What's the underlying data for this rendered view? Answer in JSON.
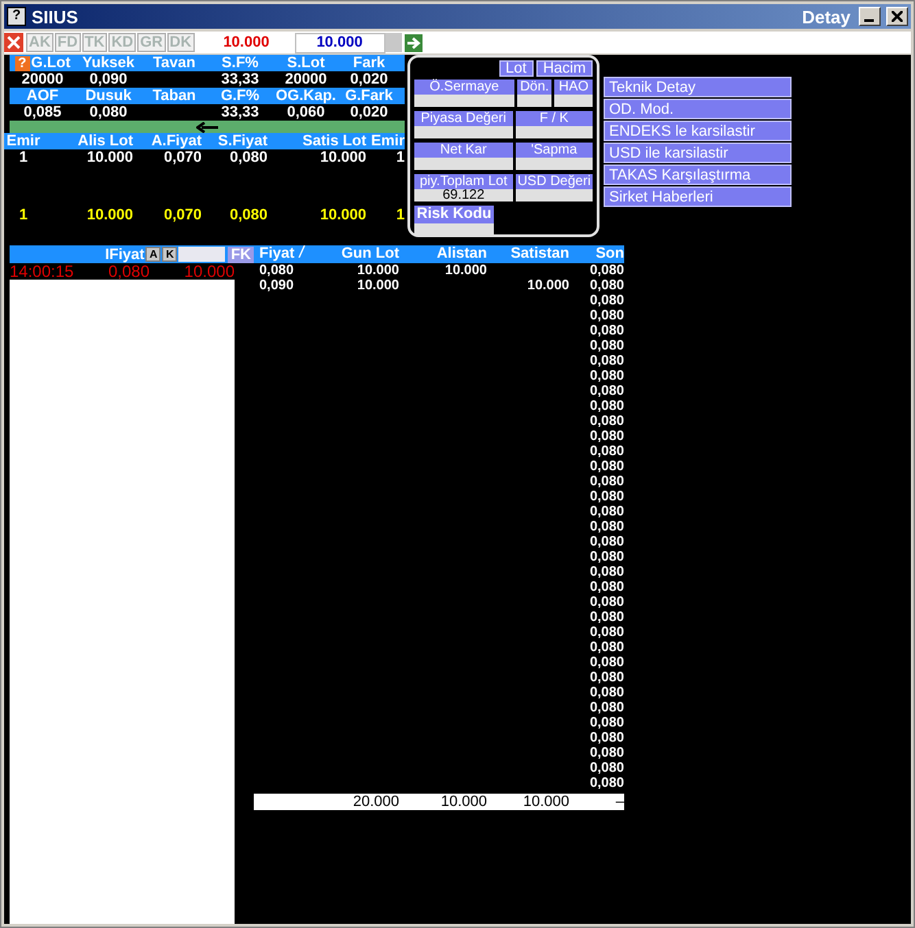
{
  "window": {
    "icon": "?",
    "title": "SIIUS",
    "subtitle": "Detay"
  },
  "toolbar": {
    "buttons": [
      {
        "label": "AK",
        "disabled": true
      },
      {
        "label": "FD",
        "disabled": true
      },
      {
        "label": "TK",
        "disabled": true
      },
      {
        "label": "KD",
        "disabled": true
      },
      {
        "label": "GR",
        "disabled": true
      },
      {
        "label": "DK",
        "disabled": true
      }
    ],
    "field_1": "10.000",
    "field_2": "10.000"
  },
  "summary": {
    "help": "?",
    "rows": [
      [
        {
          "header": "G.Lot",
          "value": "20000"
        },
        {
          "header": "Yuksek",
          "value": "0,090"
        },
        {
          "header": "Tavan"
        },
        {
          "header": "S.F%",
          "value": "33,33"
        },
        {
          "header": "S.Lot",
          "value": "20000"
        },
        {
          "header": "Fark",
          "value": "0,020"
        }
      ],
      [
        {
          "header": "AOF",
          "value": "0,085"
        },
        {
          "header": "Dusuk",
          "value": "0,080"
        },
        {
          "header": "Taban"
        },
        {
          "header": "G.F%",
          "value": "33,33"
        },
        {
          "header": "OG.Kap.",
          "value": "0,060"
        },
        {
          "header": "G.Fark",
          "value": "0,020"
        }
      ]
    ]
  },
  "order_book": {
    "columns": [
      "Emir",
      "Alis Lot",
      "A.Fiyat",
      "S.Fiyat",
      "Satis Lot",
      "Emir"
    ],
    "rows": [
      [
        "1",
        "10.000",
        "0,070",
        "0,080",
        "10.000",
        "1"
      ]
    ],
    "total": [
      "1",
      "10.000",
      "0,070",
      "0,080",
      "10.000",
      "1"
    ]
  },
  "popup": {
    "buttons": [
      "Lot",
      "Hacim"
    ],
    "rows": [
      [
        {
          "label": "Ö.Sermaye",
          "kind": "normal"
        },
        {
          "label": "Dön.",
          "kind": "normal"
        },
        {
          "label": "HAO",
          "kind": "normal"
        }
      ],
      [
        {
          "label": "Piyasa Değeri",
          "kind": "normal"
        },
        {
          "label": "F / K",
          "kind": "normal"
        }
      ],
      [
        {
          "label": "Net Kar",
          "kind": "normal"
        },
        {
          "label": "'Sapma",
          "kind": "normal"
        }
      ],
      [
        {
          "label": "piy.Toplam Lot",
          "value": "69.122",
          "kind": "normal"
        },
        {
          "label": "USD Değeri",
          "kind": "normal"
        }
      ],
      [
        {
          "label": "Risk Kodu",
          "kind": "large"
        }
      ]
    ]
  },
  "menu": [
    "Teknik Detay",
    "OD. Mod.",
    "ENDEKS le karsilastir",
    "USD ile karsilastir",
    "TAKAS Karşılaştırma",
    "Sirket Haberleri"
  ],
  "time_sales": {
    "filter_label": "IFiyat",
    "buttons": [
      "A",
      "K"
    ],
    "fk_button": "FK",
    "rows": [
      {
        "time": "14:00:15",
        "price": "0,080",
        "lot": "10.000"
      }
    ]
  },
  "trades": {
    "columns": [
      "Fiyat",
      "Gun Lot",
      "Alistan",
      "Satistan",
      "Son"
    ],
    "rows": [
      {
        "fiyat": "0,080",
        "gun_lot": "10.000",
        "alistan": "10.000",
        "son": "0,080"
      },
      {
        "fiyat": "0,090",
        "gun_lot": "10.000",
        "satistan": "10.000",
        "son": "0,080"
      },
      {
        "son": "0,080"
      },
      {
        "son": "0,080"
      },
      {
        "son": "0,080"
      },
      {
        "son": "0,080"
      },
      {
        "son": "0,080"
      },
      {
        "son": "0,080"
      },
      {
        "son": "0,080"
      },
      {
        "son": "0,080"
      },
      {
        "son": "0,080"
      },
      {
        "son": "0,080"
      },
      {
        "son": "0,080"
      },
      {
        "son": "0,080"
      },
      {
        "son": "0,080"
      },
      {
        "son": "0,080"
      },
      {
        "son": "0,080"
      },
      {
        "son": "0,080"
      },
      {
        "son": "0,080"
      },
      {
        "son": "0,080"
      },
      {
        "son": "0,080"
      },
      {
        "son": "0,080"
      },
      {
        "son": "0,080"
      },
      {
        "son": "0,080"
      },
      {
        "son": "0,080"
      },
      {
        "son": "0,080"
      },
      {
        "son": "0,080"
      },
      {
        "son": "0,080"
      },
      {
        "son": "0,080"
      },
      {
        "son": "0,080"
      },
      {
        "son": "0,080"
      },
      {
        "son": "0,080"
      },
      {
        "son": "0,080"
      },
      {
        "son": "0,080"
      },
      {
        "son": "0,080"
      }
    ],
    "totals": {
      "gun_lot": "20.000",
      "alistan": "10.000",
      "satistan": "10.000",
      "son": "–"
    }
  }
}
